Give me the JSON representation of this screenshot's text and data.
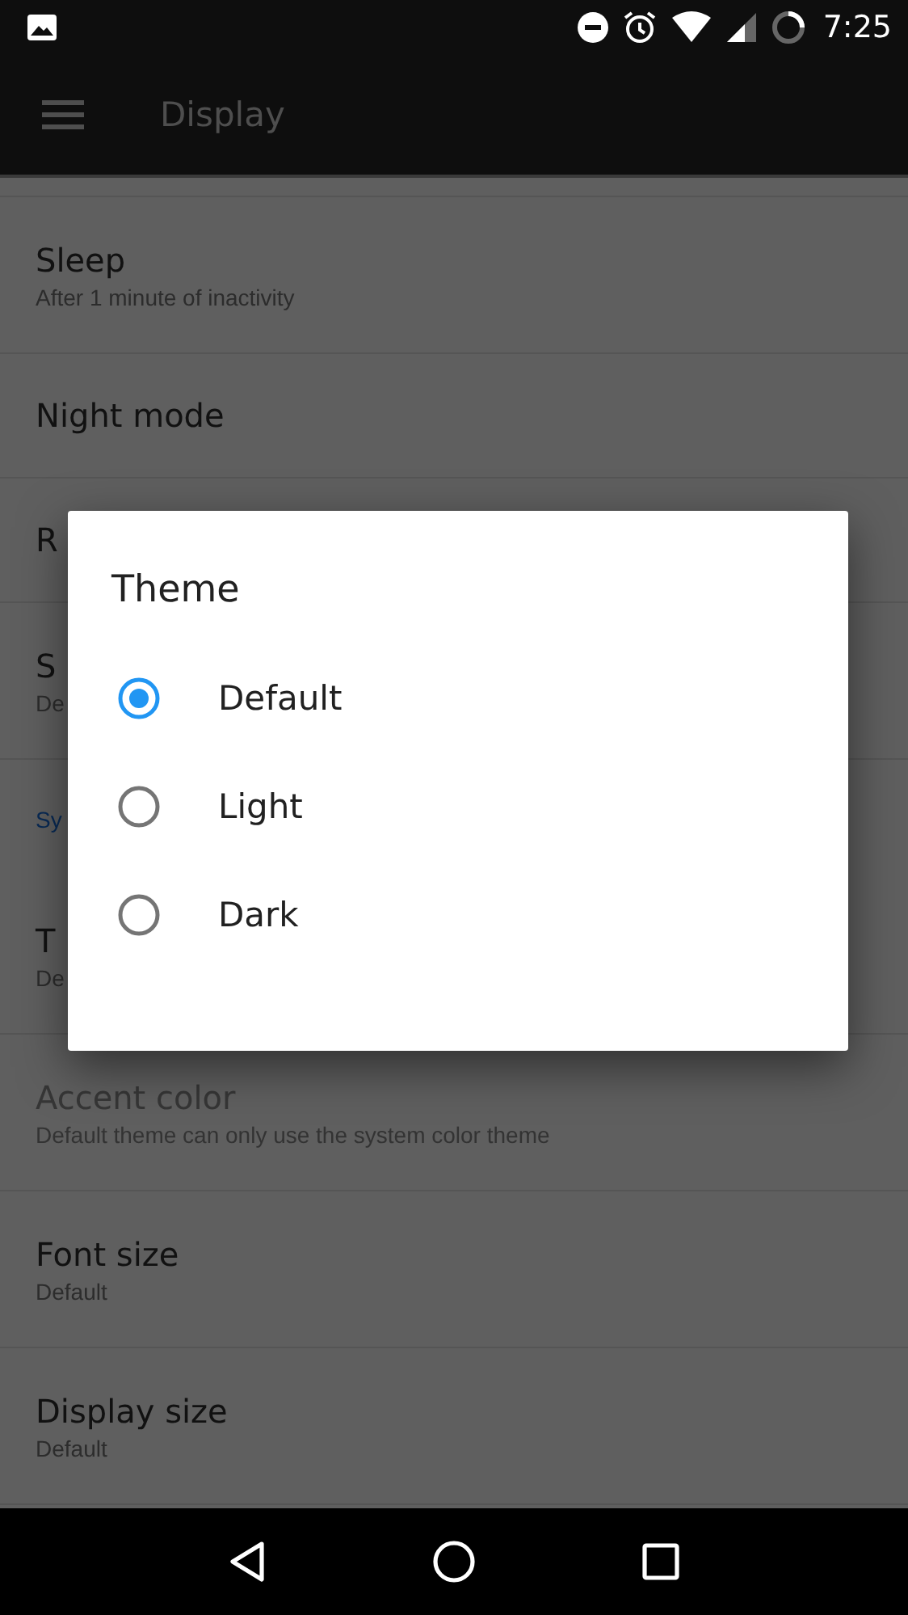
{
  "status_bar": {
    "time": "7:25"
  },
  "app_bar": {
    "title": "Display"
  },
  "settings": [
    {
      "kind": "item",
      "title": "Sleep",
      "summary": "After 1 minute of inactivity",
      "disabled": false
    },
    {
      "kind": "item",
      "title": "Night mode",
      "disabled": false
    },
    {
      "kind": "item",
      "title": "R",
      "disabled": false
    },
    {
      "kind": "item",
      "title": "S",
      "summary": "De",
      "disabled": false
    },
    {
      "kind": "category",
      "title": "Sy"
    },
    {
      "kind": "item",
      "title": "T",
      "summary": "De",
      "disabled": false
    },
    {
      "kind": "item",
      "title": "Accent color",
      "summary": "Default theme can only use the system color theme",
      "disabled": true
    },
    {
      "kind": "item",
      "title": "Font size",
      "summary": "Default",
      "disabled": false
    },
    {
      "kind": "item",
      "title": "Display size",
      "summary": "Default",
      "disabled": false
    }
  ],
  "dialog": {
    "title": "Theme",
    "options": [
      {
        "label": "Default",
        "selected": true
      },
      {
        "label": "Light",
        "selected": false
      },
      {
        "label": "Dark",
        "selected": false
      }
    ]
  }
}
